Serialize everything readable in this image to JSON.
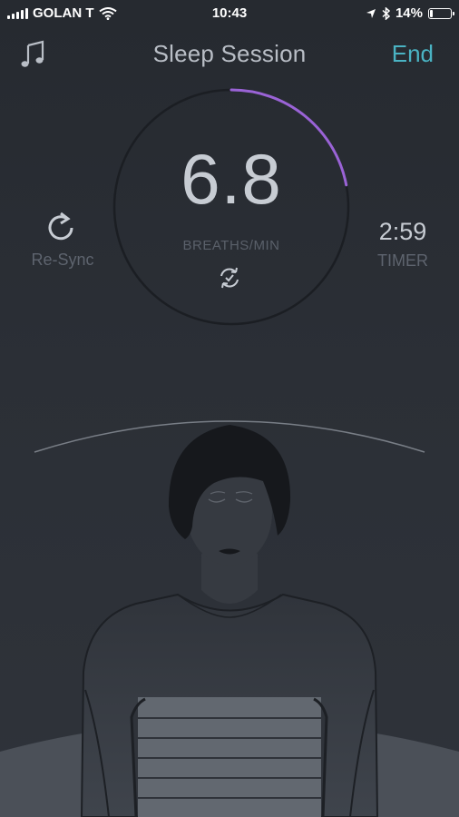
{
  "status_bar": {
    "carrier": "GOLAN T",
    "time": "10:43",
    "battery": "14%",
    "battery_level": 0.14,
    "icons": [
      "signal-icon",
      "wifi-icon",
      "location-icon",
      "bluetooth-icon",
      "battery-icon"
    ]
  },
  "header": {
    "title": "Sleep Session",
    "end_label": "End",
    "music_icon": "music-note-icon"
  },
  "dial": {
    "value": "6.8",
    "unit_label": "BREATHS/MIN",
    "progress_fraction": 0.22,
    "progress_color": "#9a63d6",
    "ring_color": "#1c1f24",
    "status_icon": "sync-check-icon"
  },
  "resync": {
    "label": "Re-Sync",
    "icon": "refresh-icon"
  },
  "timer": {
    "value": "2:59",
    "label": "TIMER"
  },
  "colors": {
    "accent": "#4ab3c3",
    "title_text": "#b9bec6",
    "muted_text": "#5e646e",
    "background": "#2b2f36"
  }
}
